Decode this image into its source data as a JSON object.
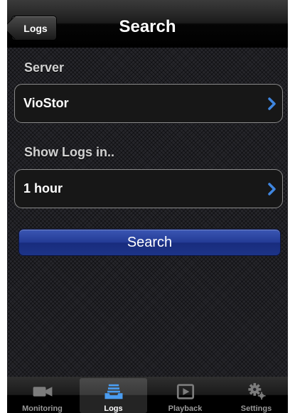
{
  "navbar": {
    "back_label": "Logs",
    "title": "Search"
  },
  "server": {
    "label": "Server",
    "value": "VioStor"
  },
  "show_logs": {
    "label": "Show Logs in..",
    "value": "1 hour"
  },
  "search_button": {
    "label": "Search"
  },
  "tabs": [
    {
      "label": "Monitoring",
      "icon": "video-camera-icon",
      "active": false
    },
    {
      "label": "Logs",
      "icon": "logs-tray-icon",
      "active": true
    },
    {
      "label": "Playback",
      "icon": "playback-icon",
      "active": false
    },
    {
      "label": "Settings",
      "icon": "gears-icon",
      "active": false
    }
  ],
  "colors": {
    "accent_chevron": "#3f86e0",
    "search_button": "#233b95",
    "active_tab_icon": "#4a9cf0"
  }
}
